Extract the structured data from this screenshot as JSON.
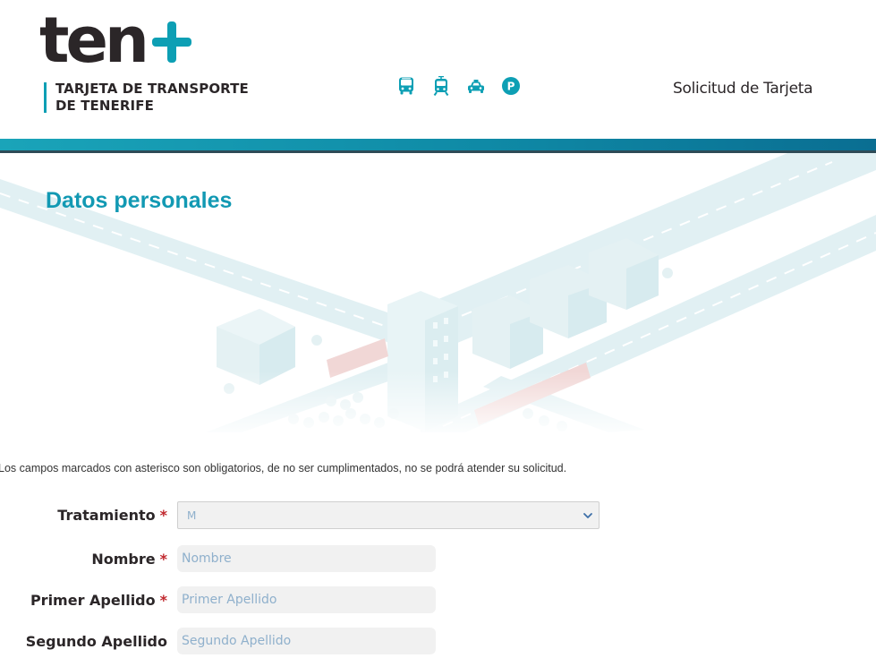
{
  "brand": {
    "wordmark": "ten",
    "subtitle_line1": "TARJETA DE TRANSPORTE",
    "subtitle_line2": "DE TENERIFE",
    "accent_color": "#0d9fb4",
    "text_color": "#2b2628"
  },
  "header": {
    "mode_icons": [
      "bus-icon",
      "tram-icon",
      "taxi-icon",
      "parking-icon"
    ],
    "page_heading": "Solicitud de Tarjeta"
  },
  "section": {
    "title": "Datos personales",
    "title_color": "#1299b3"
  },
  "notice": "Los campos marcados con asterisco son obligatorios, de no ser cumplimentados, no se podrá atender su solicitud.",
  "form": {
    "required_marker": "*",
    "required_color": "#c0272d",
    "tratamiento": {
      "label": "Tratamiento",
      "value": "M"
    },
    "nombre": {
      "label": "Nombre",
      "placeholder": "Nombre",
      "value": ""
    },
    "primer_apellido": {
      "label": "Primer Apellido",
      "placeholder": "Primer Apellido",
      "value": ""
    },
    "segundo_apellido": {
      "label": "Segundo Apellido",
      "placeholder": "Segundo Apellido",
      "value": ""
    }
  }
}
